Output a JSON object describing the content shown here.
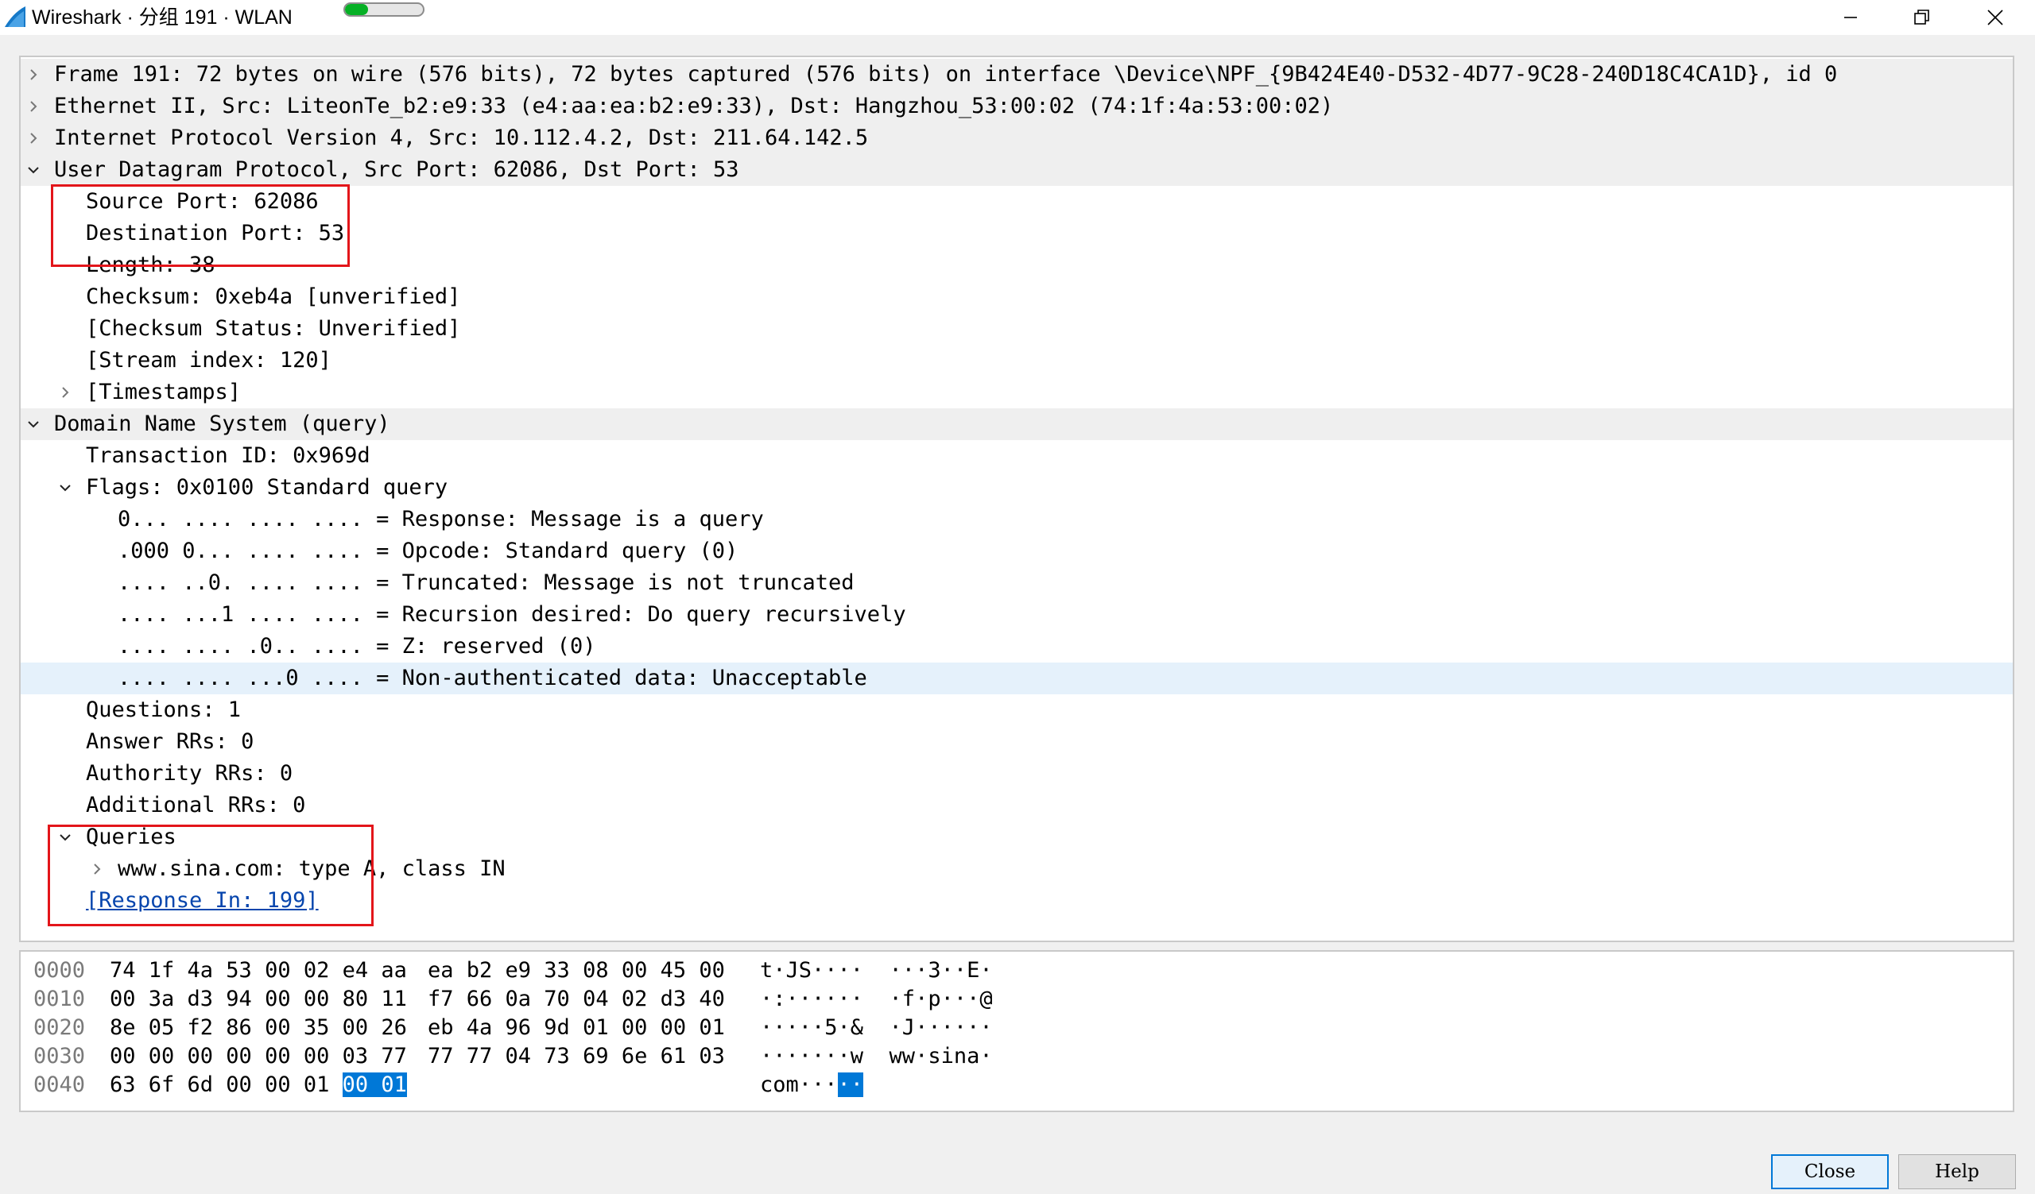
{
  "window": {
    "title": "Wireshark · 分组 191 · WLAN",
    "progress_fraction": 0.3,
    "accent": "#0078d7",
    "highlight_box_color": "#e3151a",
    "link_color": "#0645ad"
  },
  "tree": [
    {
      "text": "Frame 191: 72 bytes on wire (576 bits), 72 bytes captured (576 bits) on interface \\Device\\NPF_{9B424E40-D532-4D77-9C28-240D18C4CA1D}, id 0",
      "level": 0,
      "expander": "collapsed",
      "icon": "chevron-right-icon"
    },
    {
      "text": "Ethernet II, Src: LiteonTe_b2:e9:33 (e4:aa:ea:b2:e9:33), Dst: Hangzhou_53:00:02 (74:1f:4a:53:00:02)",
      "level": 0,
      "expander": "collapsed",
      "icon": "chevron-right-icon"
    },
    {
      "text": "Internet Protocol Version 4, Src: 10.112.4.2, Dst: 211.64.142.5",
      "level": 0,
      "expander": "collapsed",
      "icon": "chevron-right-icon"
    },
    {
      "text": "User Datagram Protocol, Src Port: 62086, Dst Port: 53",
      "level": 0,
      "expander": "expanded",
      "icon": "chevron-down-icon"
    },
    {
      "text": "Source Port: 62086",
      "level": 1
    },
    {
      "text": "Destination Port: 53",
      "level": 1
    },
    {
      "text": "Length: 38",
      "level": 1
    },
    {
      "text": "Checksum: 0xeb4a [unverified]",
      "level": 1
    },
    {
      "text": "[Checksum Status: Unverified]",
      "level": 1
    },
    {
      "text": "[Stream index: 120]",
      "level": 1
    },
    {
      "text": "[Timestamps]",
      "level": 1,
      "expander": "collapsed",
      "icon": "chevron-right-icon"
    },
    {
      "text": "Domain Name System (query)",
      "level": 0,
      "expander": "expanded",
      "icon": "chevron-down-icon"
    },
    {
      "text": "Transaction ID: 0x969d",
      "level": 1
    },
    {
      "text": "Flags: 0x0100 Standard query",
      "level": 1,
      "expander": "expanded",
      "icon": "chevron-down-icon"
    },
    {
      "text": "0... .... .... .... = Response: Message is a query",
      "level": 2
    },
    {
      "text": ".000 0... .... .... = Opcode: Standard query (0)",
      "level": 2
    },
    {
      "text": ".... ..0. .... .... = Truncated: Message is not truncated",
      "level": 2
    },
    {
      "text": ".... ...1 .... .... = Recursion desired: Do query recursively",
      "level": 2
    },
    {
      "text": ".... .... .0.. .... = Z: reserved (0)",
      "level": 2
    },
    {
      "text": ".... .... ...0 .... = Non-authenticated data: Unacceptable",
      "level": 2,
      "selected": true
    },
    {
      "text": "Questions: 1",
      "level": 1
    },
    {
      "text": "Answer RRs: 0",
      "level": 1
    },
    {
      "text": "Authority RRs: 0",
      "level": 1
    },
    {
      "text": "Additional RRs: 0",
      "level": 1
    },
    {
      "text": "Queries",
      "level": 1,
      "expander": "expanded",
      "icon": "chevron-down-icon"
    },
    {
      "text": "www.sina.com: type A, class IN",
      "level": 2,
      "expander": "collapsed",
      "icon": "chevron-right-icon"
    },
    {
      "text": "[Response In: 199]",
      "level": 1,
      "link": true
    }
  ],
  "hex": [
    {
      "offset": "0000",
      "b1": "74 1f 4a 53 00 02 e4 aa",
      "b2": "ea b2 e9 33 08 00 45 00",
      "ascii": "t·JS····  ···3··E·"
    },
    {
      "offset": "0010",
      "b1": "00 3a d3 94 00 00 80 11",
      "b2": "f7 66 0a 70 04 02 d3 40",
      "ascii": "·:······  ·f·p···@"
    },
    {
      "offset": "0020",
      "b1": "8e 05 f2 86 00 35 00 26",
      "b2": "eb 4a 96 9d 01 00 00 01",
      "ascii": "·····5·&  ·J······"
    },
    {
      "offset": "0030",
      "b1": "00 00 00 00 00 00 03 77",
      "b2": "77 77 04 73 69 6e 61 03",
      "ascii": "·······w  ww·sina·"
    },
    {
      "offset": "0040",
      "b1": "63 6f 6d 00 00 01",
      "b1_hl": "00 01",
      "b2": "",
      "ascii": "com···",
      "ascii_hl": "··"
    }
  ],
  "buttons": {
    "close": "Close",
    "help": "Help"
  }
}
